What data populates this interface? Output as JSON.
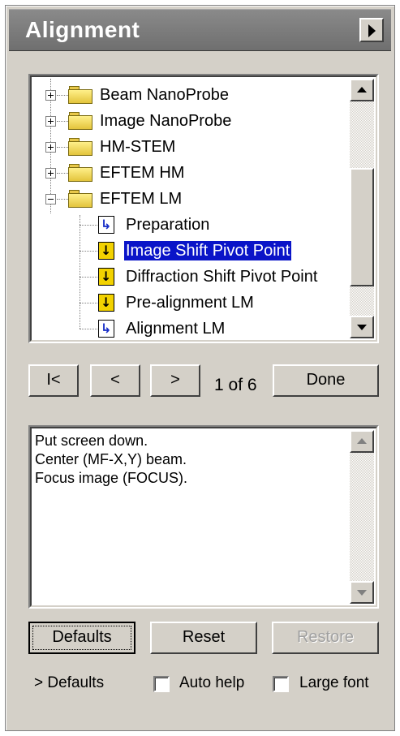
{
  "window": {
    "title": "Alignment",
    "menu_icon": "triangle-right-icon"
  },
  "tree": {
    "items": [
      {
        "label": "Beam NanoProbe",
        "type": "folder",
        "expander": "+"
      },
      {
        "label": "Image NanoProbe",
        "type": "folder",
        "expander": "+"
      },
      {
        "label": "HM-STEM",
        "type": "folder",
        "expander": "+"
      },
      {
        "label": "EFTEM HM",
        "type": "folder",
        "expander": "+"
      },
      {
        "label": "EFTEM LM",
        "type": "folder",
        "expander": "-"
      },
      {
        "label": "Preparation",
        "type": "doc-blue"
      },
      {
        "label": "Image Shift Pivot Point",
        "type": "doc-yellow",
        "selected": true
      },
      {
        "label": "Diffraction Shift Pivot Point",
        "type": "doc-yellow"
      },
      {
        "label": "Pre-alignment LM",
        "type": "doc-yellow"
      },
      {
        "label": "Alignment LM",
        "type": "doc-blue"
      }
    ]
  },
  "navigation": {
    "first_label": "I<",
    "prev_label": "<",
    "next_label": ">",
    "page_text": "1 of 6",
    "done_label": "Done"
  },
  "help": {
    "lines": [
      "Put screen down.",
      "Center (MF-X,Y) beam.",
      "Focus image (FOCUS)."
    ]
  },
  "buttons": {
    "defaults_label": "Defaults",
    "reset_label": "Reset",
    "restore_label": "Restore"
  },
  "footer": {
    "defaults_link": "> Defaults",
    "auto_help_label": "Auto help",
    "auto_help_checked": false,
    "large_font_label": "Large font",
    "large_font_checked": false
  },
  "colors": {
    "panel_bg": "#d4d0c8",
    "titlebar_bg": "#7a7a7a",
    "selection_bg": "#0a14c8",
    "folder_yellow": "#f2d24a"
  }
}
